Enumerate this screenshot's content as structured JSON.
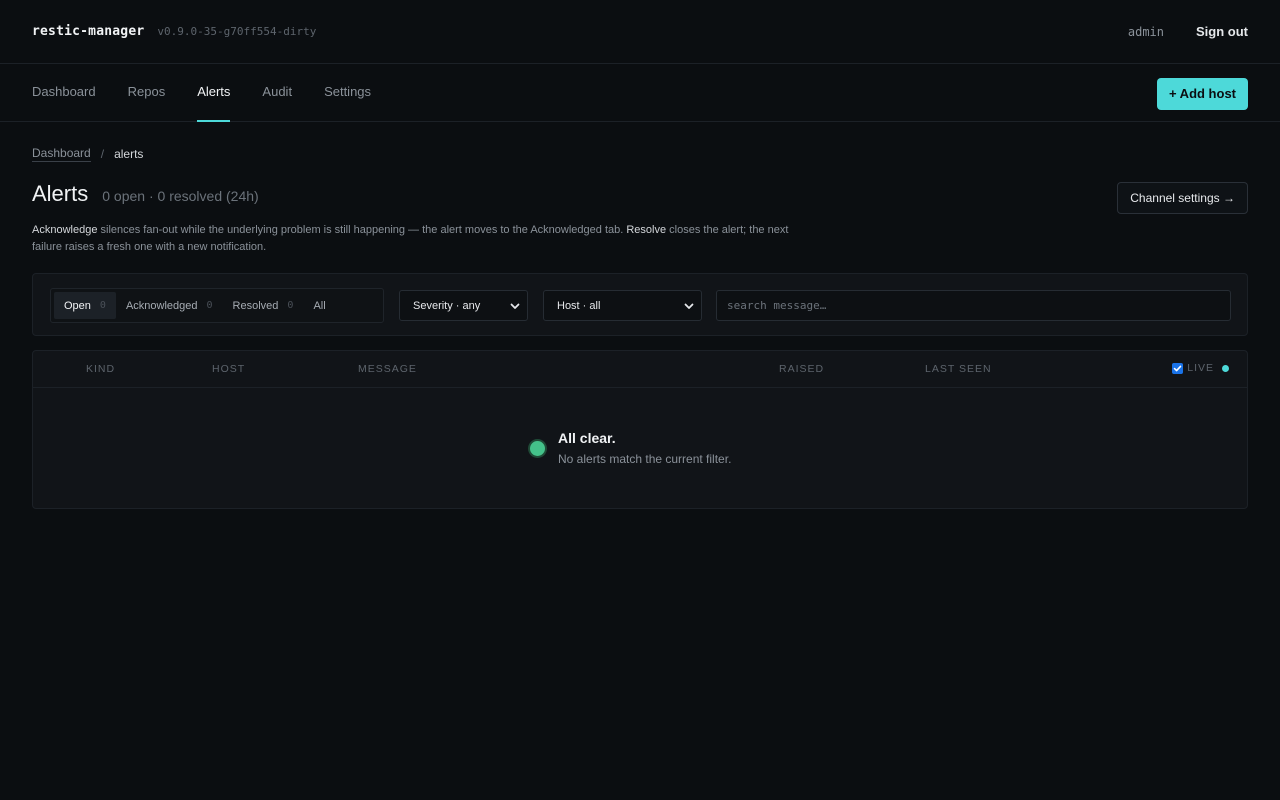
{
  "header": {
    "brand": "restic-manager",
    "version": "v0.9.0-35-g70ff554-dirty",
    "user": "admin",
    "sign_out": "Sign out"
  },
  "nav": {
    "tabs": [
      {
        "label": "Dashboard",
        "active": false
      },
      {
        "label": "Repos",
        "active": false
      },
      {
        "label": "Alerts",
        "active": true
      },
      {
        "label": "Audit",
        "active": false
      },
      {
        "label": "Settings",
        "active": false
      }
    ],
    "add_host": "+ Add host"
  },
  "breadcrumb": {
    "root": "Dashboard",
    "separator": "/",
    "current": "alerts"
  },
  "page": {
    "title": "Alerts",
    "subtitle": "0 open · 0 resolved (24h)",
    "channel_settings": "Channel settings →",
    "desc_ack": "Acknowledge",
    "desc_part1": " silences fan-out while the underlying problem is still happening — the alert moves to the Acknowledged tab. ",
    "desc_resolve": "Resolve",
    "desc_part2": " closes the alert; the next failure raises a fresh one with a new notification."
  },
  "filters": {
    "status_tabs": [
      {
        "label": "Open",
        "count": "0",
        "active": true
      },
      {
        "label": "Acknowledged",
        "count": "0",
        "active": false
      },
      {
        "label": "Resolved",
        "count": "0",
        "active": false
      },
      {
        "label": "All",
        "count": "",
        "active": false
      }
    ],
    "severity": "Severity · any",
    "host": "Host · all",
    "search_placeholder": "search message…"
  },
  "table": {
    "columns": [
      "KIND",
      "HOST",
      "MESSAGE",
      "RAISED",
      "LAST SEEN"
    ],
    "live_label": "LIVE",
    "live_checked": true,
    "empty_title": "All clear.",
    "empty_message": "No alerts match the current filter."
  },
  "colors": {
    "background": "#0b0e11",
    "accent": "#4dd9d9",
    "ok": "#44c28a"
  }
}
